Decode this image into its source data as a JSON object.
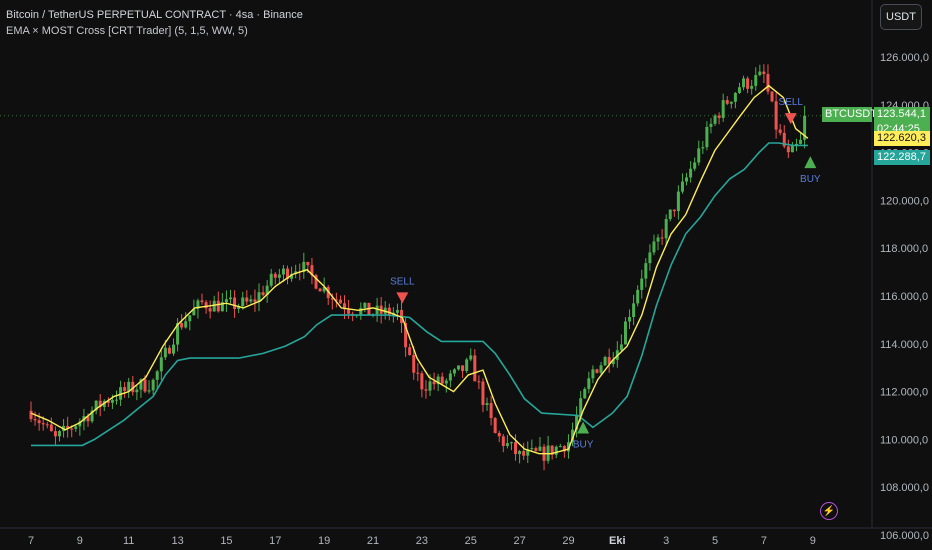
{
  "header": {
    "symbol_line": "Bitcoin / TetherUS PERPETUAL CONTRACT · 4sa · Binance",
    "indicator_line": "EMA × MOST Cross [CRT Trader] (5, 1,5, WW, 5)",
    "currency_button": "USDT"
  },
  "colors": {
    "background": "#0f0f0f",
    "up_candle": "#4caf50",
    "down_candle": "#ef5350",
    "ema_line": "#ffee58",
    "most_line": "#26a69a",
    "buy_marker": "#4caf50",
    "sell_marker": "#ef5350",
    "signal_text": "#5b7fd9"
  },
  "icons": {
    "bolt": "lightning-icon"
  },
  "price_tags": {
    "symbol": "BTCUSDT.P",
    "last_price": "123.544,1",
    "countdown": "02:44:25",
    "ema_value": "122.620,3",
    "most_value": "122.288,7"
  },
  "chart_data": {
    "type": "candlestick",
    "y_axis": {
      "range": [
        105500,
        127000
      ],
      "tick_labels": [
        "126.000,0",
        "124.000,0",
        "122.000,0",
        "120.000,0",
        "118.000,0",
        "116.000,0",
        "114.000,0",
        "112.000,0",
        "110.000,0",
        "108.000,0",
        "106.000,0"
      ],
      "tick_values": [
        126000,
        124000,
        122000,
        120000,
        118000,
        116000,
        114000,
        112000,
        110000,
        108000,
        106000
      ]
    },
    "x_axis": {
      "tick_labels": [
        "7",
        "9",
        "11",
        "13",
        "15",
        "17",
        "19",
        "21",
        "23",
        "25",
        "27",
        "29",
        "Eki",
        "3",
        "5",
        "7",
        "9"
      ],
      "tick_days": [
        0,
        2,
        4,
        6,
        8,
        10,
        12,
        14,
        16,
        18,
        20,
        22,
        24,
        26,
        28,
        30,
        32
      ]
    },
    "ema_series": [
      [
        0,
        111100
      ],
      [
        0.7,
        110800
      ],
      [
        1.4,
        110400
      ],
      [
        2,
        110700
      ],
      [
        2.7,
        111300
      ],
      [
        3.4,
        111800
      ],
      [
        4,
        112000
      ],
      [
        4.7,
        112600
      ],
      [
        5.4,
        113900
      ],
      [
        6,
        114800
      ],
      [
        6.7,
        115500
      ],
      [
        7.4,
        115600
      ],
      [
        8,
        115700
      ],
      [
        8.7,
        115500
      ],
      [
        9.4,
        115800
      ],
      [
        10,
        116400
      ],
      [
        10.7,
        116900
      ],
      [
        11.3,
        117100
      ],
      [
        12,
        116400
      ],
      [
        12.7,
        115500
      ],
      [
        13.4,
        115400
      ],
      [
        14,
        115500
      ],
      [
        14.7,
        115300
      ],
      [
        15.2,
        115100
      ],
      [
        15.8,
        113400
      ],
      [
        16.3,
        112600
      ],
      [
        16.8,
        112300
      ],
      [
        17.3,
        112000
      ],
      [
        17.9,
        112700
      ],
      [
        18.5,
        112900
      ],
      [
        19,
        111500
      ],
      [
        19.6,
        110200
      ],
      [
        20.2,
        109600
      ],
      [
        20.8,
        109400
      ],
      [
        21.3,
        109400
      ],
      [
        22,
        109600
      ],
      [
        22.6,
        111200
      ],
      [
        23.2,
        112500
      ],
      [
        23.8,
        113300
      ],
      [
        24.4,
        113900
      ],
      [
        25,
        115200
      ],
      [
        25.6,
        117200
      ],
      [
        26.2,
        118600
      ],
      [
        26.8,
        119400
      ],
      [
        27.4,
        120800
      ],
      [
        28,
        122100
      ],
      [
        28.5,
        122800
      ],
      [
        29,
        123500
      ],
      [
        29.6,
        124300
      ],
      [
        30.2,
        124800
      ],
      [
        30.8,
        124300
      ],
      [
        31.3,
        123000
      ],
      [
        31.8,
        122600
      ]
    ],
    "most_series": [
      [
        0,
        109750
      ],
      [
        1.4,
        109750
      ],
      [
        2.1,
        109750
      ],
      [
        2.6,
        110000
      ],
      [
        3.2,
        110400
      ],
      [
        3.8,
        110800
      ],
      [
        4.4,
        111300
      ],
      [
        5,
        111800
      ],
      [
        5.5,
        112700
      ],
      [
        6,
        113300
      ],
      [
        6.5,
        113400
      ],
      [
        8.5,
        113400
      ],
      [
        9.5,
        113600
      ],
      [
        10.4,
        113900
      ],
      [
        11.2,
        114300
      ],
      [
        11.7,
        114800
      ],
      [
        12.3,
        115200
      ],
      [
        14.6,
        115200
      ],
      [
        15.5,
        115100
      ],
      [
        16.2,
        114500
      ],
      [
        16.8,
        114100
      ],
      [
        18.5,
        114100
      ],
      [
        19,
        113600
      ],
      [
        19.6,
        112700
      ],
      [
        20.2,
        111700
      ],
      [
        20.9,
        111100
      ],
      [
        22.4,
        111000
      ],
      [
        23,
        110500
      ],
      [
        23.8,
        111100
      ],
      [
        24.4,
        111800
      ],
      [
        25,
        113500
      ],
      [
        25.6,
        115600
      ],
      [
        26.2,
        117300
      ],
      [
        26.8,
        118600
      ],
      [
        27.4,
        119300
      ],
      [
        28,
        120200
      ],
      [
        28.6,
        120900
      ],
      [
        29.2,
        121300
      ],
      [
        29.8,
        122000
      ],
      [
        30.2,
        122400
      ],
      [
        30.6,
        122400
      ],
      [
        31.2,
        122300
      ],
      [
        31.8,
        122300
      ]
    ],
    "anchor_closes": [
      [
        0,
        111200
      ],
      [
        1,
        110000
      ],
      [
        2,
        110800
      ],
      [
        3,
        111600
      ],
      [
        4,
        112100
      ],
      [
        5,
        112400
      ],
      [
        6,
        114700
      ],
      [
        7,
        115700
      ],
      [
        8,
        115600
      ],
      [
        9,
        115700
      ],
      [
        10,
        116800
      ],
      [
        11,
        117300
      ],
      [
        12,
        116300
      ],
      [
        13,
        115500
      ],
      [
        14,
        115300
      ],
      [
        15,
        115300
      ],
      [
        15.5,
        113200
      ],
      [
        16,
        112300
      ],
      [
        17,
        112400
      ],
      [
        18,
        113200
      ],
      [
        19,
        110200
      ],
      [
        20,
        109300
      ],
      [
        21,
        109400
      ],
      [
        22,
        109900
      ],
      [
        23,
        112900
      ],
      [
        24,
        113800
      ],
      [
        25,
        116900
      ],
      [
        26,
        119000
      ],
      [
        27,
        121300
      ],
      [
        28,
        123500
      ],
      [
        29,
        124800
      ],
      [
        30,
        125200
      ],
      [
        30.5,
        123100
      ],
      [
        31,
        121800
      ],
      [
        31.5,
        122400
      ],
      [
        31.8,
        123544
      ]
    ],
    "signals": [
      {
        "type": "SELL",
        "day": 15.2,
        "price": 115900,
        "label": "SELL"
      },
      {
        "type": "BUY",
        "day": 22.6,
        "price": 110500,
        "label": "BUY"
      },
      {
        "type": "SELL",
        "day": 31.1,
        "price": 123400,
        "label": "SELL"
      },
      {
        "type": "BUY",
        "day": 31.9,
        "price": 121600,
        "label": "BUY"
      }
    ],
    "current_price": 123544.1,
    "grid": "horizontal-dotted-none",
    "legend": "none"
  }
}
